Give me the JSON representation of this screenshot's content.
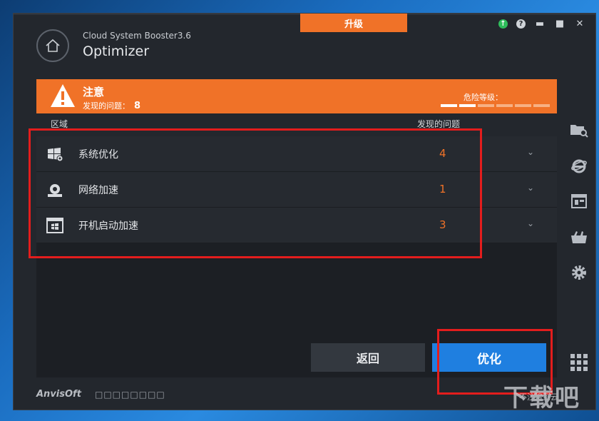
{
  "window": {
    "upgrade_tab": "升级",
    "app_name": "Cloud System Booster3.6",
    "app_title": "Optimizer"
  },
  "alert": {
    "title": "注意",
    "found_label": "发现的问题：",
    "found_count": "8",
    "danger_label": "危险等级：",
    "danger_level": 2,
    "danger_max": 6
  },
  "table": {
    "col_area": "区域",
    "col_found": "发现的问题",
    "rows": [
      {
        "label": "系统优化",
        "count": "4",
        "icon": "system-optimize-icon"
      },
      {
        "label": "网络加速",
        "count": "1",
        "icon": "network-accelerate-icon"
      },
      {
        "label": "开机启动加速",
        "count": "3",
        "icon": "startup-accelerate-icon"
      }
    ]
  },
  "buttons": {
    "back": "返回",
    "optimize": "优化"
  },
  "footer": {
    "logo": "AnvisOft",
    "logo_sub": "□□□□□□□□"
  },
  "watermark": {
    "big": "下载吧",
    "small": "不注搜到云"
  },
  "colors": {
    "accent_orange": "#f07228",
    "accent_blue": "#1f7fe0",
    "highlight_red": "#e31d1d"
  }
}
